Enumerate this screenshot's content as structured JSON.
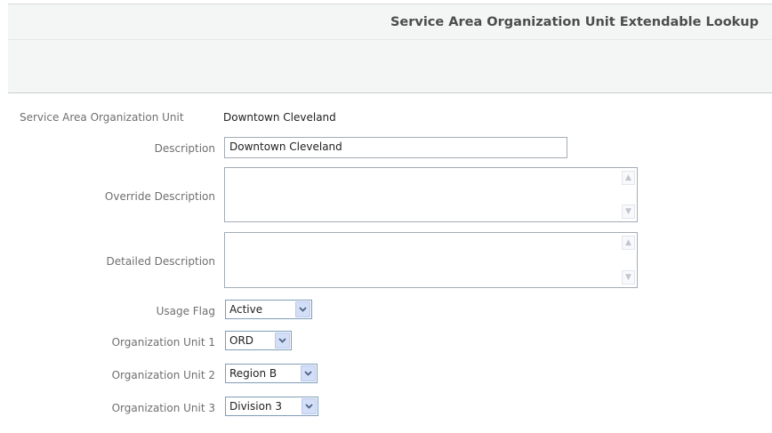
{
  "header": {
    "title": "Service Area Organization Unit Extendable Lookup"
  },
  "form": {
    "service_area_org_unit": {
      "label": "Service Area Organization Unit",
      "value": "Downtown Cleveland"
    },
    "description": {
      "label": "Description",
      "value": "Downtown Cleveland"
    },
    "override_description": {
      "label": "Override Description",
      "value": ""
    },
    "detailed_description": {
      "label": "Detailed Description",
      "value": ""
    },
    "usage_flag": {
      "label": "Usage Flag",
      "value": "Active"
    },
    "org_unit_1": {
      "label": "Organization Unit 1",
      "value": "ORD"
    },
    "org_unit_2": {
      "label": "Organization Unit 2",
      "value": "Region B"
    },
    "org_unit_3": {
      "label": "Organization Unit 3",
      "value": "Division 3"
    }
  },
  "icons": {
    "dropdown": "chevron-down-icon",
    "scroll_up": "arrow-up-icon",
    "scroll_down": "arrow-down-icon"
  },
  "colors": {
    "title_text": "#4c4c4c",
    "label_text": "#6f6f6f",
    "header_band": "#f4f6f6",
    "dropdown_button": "#d3def7",
    "dropdown_arrow": "#4d6185"
  }
}
